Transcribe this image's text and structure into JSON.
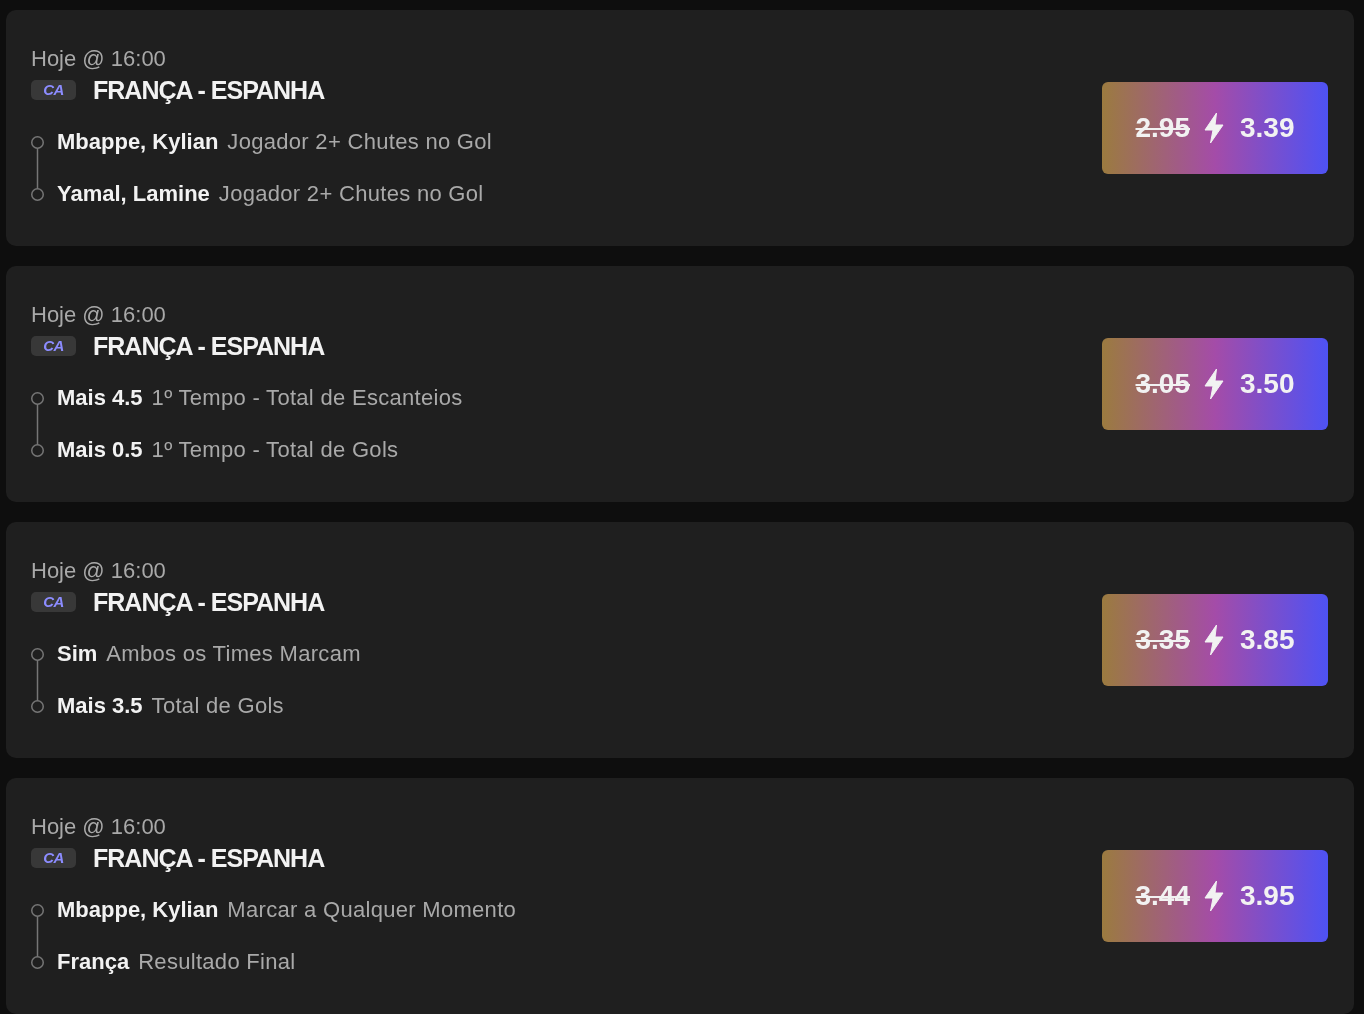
{
  "bets": [
    {
      "time": "Hoje @ 16:00",
      "competition_badge": "CA",
      "match": "FRANÇA - ESPANHA",
      "legs": [
        {
          "selection": "Mbappe, Kylian",
          "market": "Jogador 2+ Chutes no Gol"
        },
        {
          "selection": "Yamal, Lamine",
          "market": "Jogador 2+ Chutes no Gol"
        }
      ],
      "odds": {
        "old": "2.95",
        "boosted": "3.39"
      }
    },
    {
      "time": "Hoje @ 16:00",
      "competition_badge": "CA",
      "match": "FRANÇA - ESPANHA",
      "legs": [
        {
          "selection": "Mais 4.5",
          "market": "1º Tempo - Total de Escanteios"
        },
        {
          "selection": "Mais 0.5",
          "market": "1º Tempo - Total de Gols"
        }
      ],
      "odds": {
        "old": "3.05",
        "boosted": "3.50"
      }
    },
    {
      "time": "Hoje @ 16:00",
      "competition_badge": "CA",
      "match": "FRANÇA - ESPANHA",
      "legs": [
        {
          "selection": "Sim",
          "market": "Ambos os Times Marcam"
        },
        {
          "selection": "Mais 3.5",
          "market": "Total de Gols"
        }
      ],
      "odds": {
        "old": "3.35",
        "boosted": "3.85"
      }
    },
    {
      "time": "Hoje @ 16:00",
      "competition_badge": "CA",
      "match": "FRANÇA - ESPANHA",
      "legs": [
        {
          "selection": "Mbappe, Kylian",
          "market": "Marcar a Qualquer Momento"
        },
        {
          "selection": "França",
          "market": "Resultado Final"
        }
      ],
      "odds": {
        "old": "3.44",
        "boosted": "3.95"
      }
    }
  ]
}
